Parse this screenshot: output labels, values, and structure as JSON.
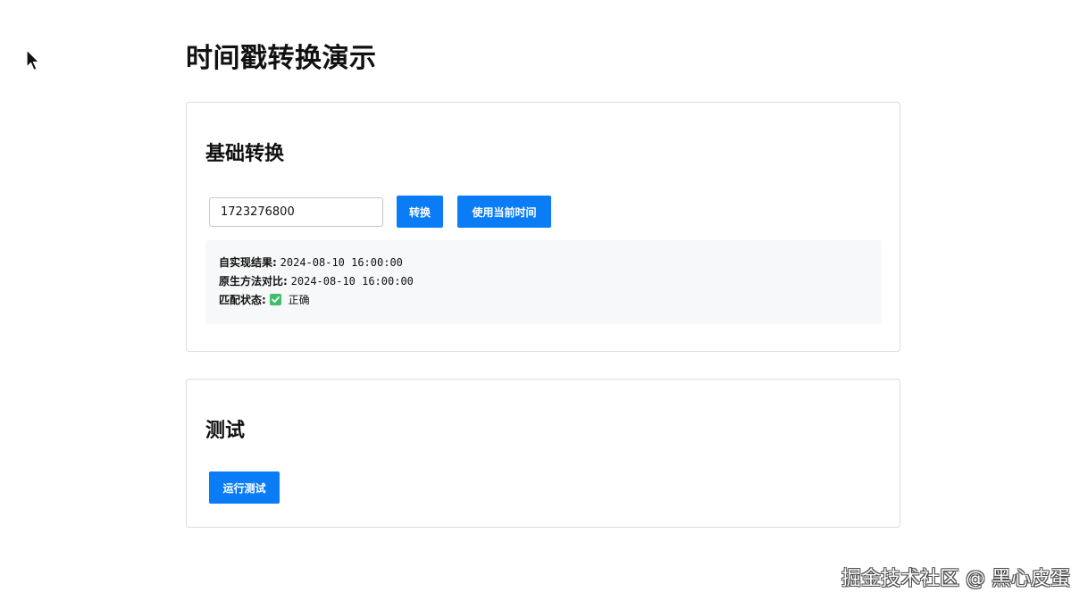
{
  "page": {
    "title": "时间戳转换演示"
  },
  "basic_card": {
    "title": "基础转换",
    "timestamp_input_value": "1723276800",
    "convert_label": "转换",
    "use_now_label": "使用当前时间",
    "result": {
      "custom_label": "自实现结果:",
      "custom_value": "2024-08-10 16:00:00",
      "native_label": "原生方法对比:",
      "native_value": "2024-08-10 16:00:00",
      "match_label": "匹配状态:",
      "match_icon": "check-icon",
      "match_value": "正确",
      "match_color": "#3fbf6b"
    }
  },
  "test_card": {
    "title": "测试",
    "run_label": "运行测试"
  },
  "watermark": {
    "text": "掘金技术社区 @ 黑心皮蛋"
  },
  "colors": {
    "accent": "#0a7cf5",
    "result_bg": "#f7f8f9",
    "card_border": "#dcdcdc"
  }
}
